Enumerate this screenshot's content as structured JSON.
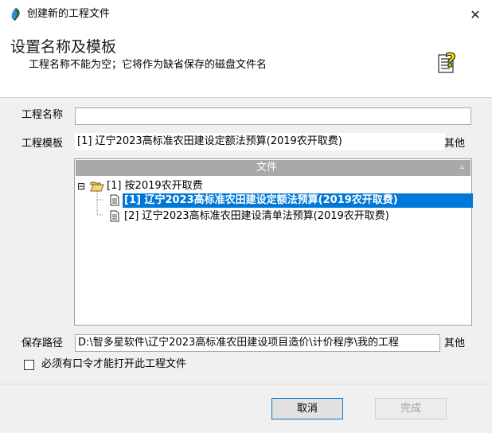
{
  "window": {
    "title": "创建新的工程文件",
    "close_glyph": "✕"
  },
  "header": {
    "title": "设置名称及模板",
    "subtitle": "工程名称不能为空；它将作为缺省保存的磁盘文件名"
  },
  "form": {
    "name_label": "工程名称",
    "name_value": "",
    "template_label": "工程模板",
    "template_value": "[1] 辽宁2023高标准农田建设定额法预算(2019农开取费)",
    "template_other": "其他",
    "path_label": "保存路径",
    "path_value": "D:\\智多星软件\\辽宁2023高标准农田建设项目造价\\计价程序\\我的工程",
    "path_other": "其他"
  },
  "tree": {
    "header_label": "文件",
    "sort_glyph": "▵",
    "folder": {
      "toggle": "⊟",
      "label": "[1] 按2019农开取费"
    },
    "items": [
      {
        "label": "[1] 辽宁2023高标准农田建设定额法预算(2019农开取费)",
        "selected": true
      },
      {
        "label": "[2] 辽宁2023高标准农田建设清单法预算(2019农开取费)",
        "selected": false
      }
    ]
  },
  "options": {
    "password_label": "必须有口令才能打开此工程文件",
    "password_checked": false
  },
  "buttons": {
    "cancel": "取消",
    "finish": "完成"
  },
  "icons": {
    "app": "app-logo-icon",
    "help": "help-document-icon",
    "folder": "folder-open-icon",
    "file": "document-icon"
  }
}
